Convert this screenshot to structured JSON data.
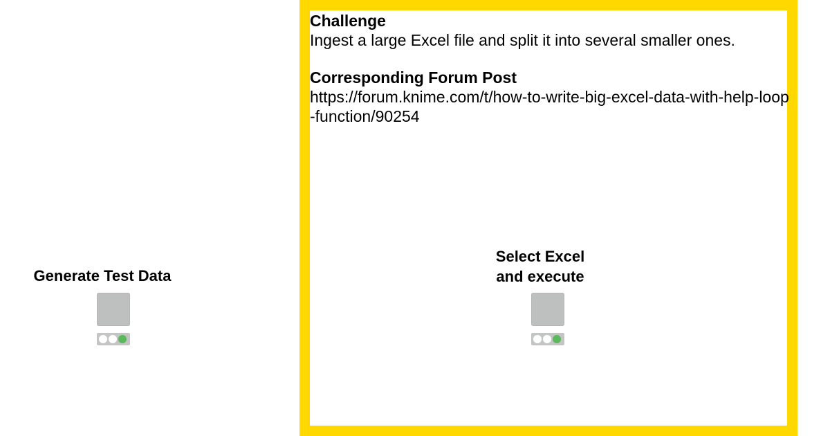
{
  "annotation": {
    "challenge_heading": "Challenge",
    "challenge_text": "Ingest a large Excel file and split it into several smaller ones.",
    "forum_heading": "Corresponding Forum Post",
    "forum_link": "https://forum.knime.com/t/how-to-write-big-excel-data-with-help-loop-function/90254",
    "border_color": "#FFD800"
  },
  "nodes": [
    {
      "label": "Generate Test Data",
      "icon": "node-icon",
      "status": "executed",
      "status_color": "#5cb85c"
    },
    {
      "label": "Select Excel\nand execute",
      "icon": "node-icon",
      "status": "executed",
      "status_color": "#5cb85c"
    }
  ]
}
